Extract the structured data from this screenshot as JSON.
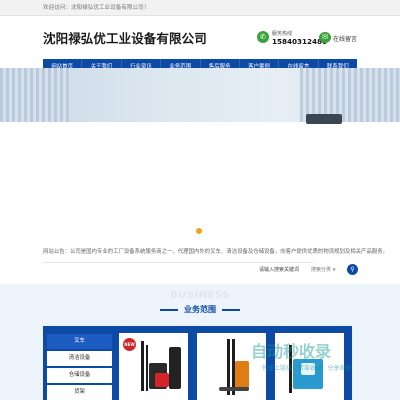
{
  "topbar": {
    "welcome": "欢迎访问：沈阳禄弘优工业设备有限公司！"
  },
  "header": {
    "logo_text": "沈阳禄弘优工业设备有限公司",
    "phone_label": "服务热线",
    "phone_number": "15840312486",
    "message_label": "在线留言"
  },
  "nav": {
    "items": [
      "网站首页",
      "关于我们",
      "行业资讯",
      "业务范围",
      "售后服务",
      "客户案例",
      "在线留言",
      "联系我们"
    ]
  },
  "notice": {
    "text": "网站公告：公司是国内专业的工厂设备系统服务商之一，代理国内外的叉车、清洁设备及仓储设备，向客户提供优质的物流规划及相关产品服务。"
  },
  "search": {
    "hint": "请输入搜索关键词",
    "category": "搜索分类",
    "caret": "▼",
    "icon": "search-icon"
  },
  "business": {
    "bg_title": "BUSINESS",
    "title": "业务范围",
    "categories": [
      "叉车",
      "清洁设备",
      "仓储设备",
      "货架"
    ],
    "active_index": 0,
    "new_badge": "NEW"
  },
  "watermark": {
    "text": "自动秒收录",
    "subtitle": "快速上链接 · 精准收录 · 分享收录"
  },
  "colors": {
    "brand": "#0d4aa6",
    "accent_green": "#3aa23a",
    "dot": "#f2a516"
  }
}
